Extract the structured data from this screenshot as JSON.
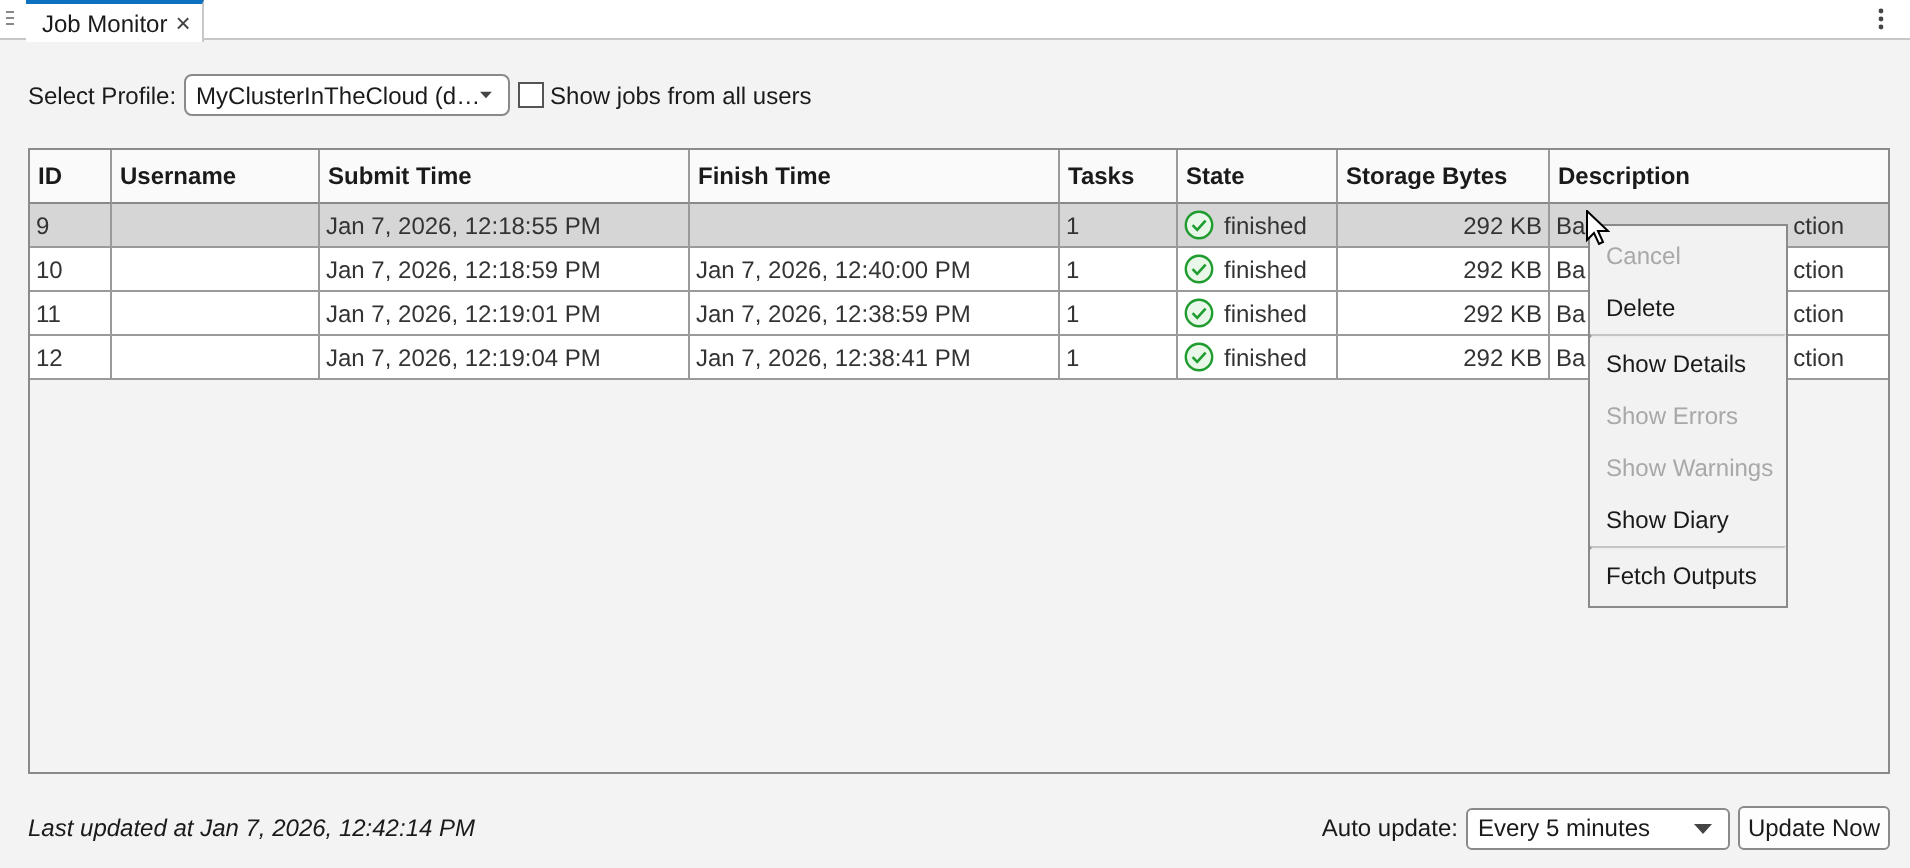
{
  "tab": {
    "title": "Job Monitor",
    "close": "×"
  },
  "profile": {
    "label": "Select Profile:",
    "value": "MyClusterInTheCloud (d…"
  },
  "show_all_users": {
    "label": "Show jobs from all users",
    "checked": false
  },
  "table": {
    "columns": [
      "ID",
      "Username",
      "Submit Time",
      "Finish Time",
      "Tasks",
      "State",
      "Storage Bytes",
      "Description"
    ],
    "rows": [
      {
        "id": "9",
        "username": "",
        "submit_time": "Jan 7, 2026, 12:18:55 PM",
        "finish_time": "",
        "tasks": "1",
        "state": "finished",
        "storage": "292 KB",
        "description_start": "Ba",
        "description_end": "ction",
        "selected": true
      },
      {
        "id": "10",
        "username": "",
        "submit_time": "Jan 7, 2026, 12:18:59 PM",
        "finish_time": "Jan 7, 2026, 12:40:00 PM",
        "tasks": "1",
        "state": "finished",
        "storage": "292 KB",
        "description_start": "Ba",
        "description_end": "ction",
        "selected": false
      },
      {
        "id": "11",
        "username": "",
        "submit_time": "Jan 7, 2026, 12:19:01 PM",
        "finish_time": "Jan 7, 2026, 12:38:59 PM",
        "tasks": "1",
        "state": "finished",
        "storage": "292 KB",
        "description_start": "Ba",
        "description_end": "ction",
        "selected": false
      },
      {
        "id": "12",
        "username": "",
        "submit_time": "Jan 7, 2026, 12:19:04 PM",
        "finish_time": "Jan 7, 2026, 12:38:41 PM",
        "tasks": "1",
        "state": "finished",
        "storage": "292 KB",
        "description_start": "Ba",
        "description_end": "ction",
        "selected": false
      }
    ]
  },
  "context_menu": [
    {
      "label": "Cancel",
      "disabled": true,
      "separator_before": false
    },
    {
      "label": "Delete",
      "disabled": false,
      "separator_before": false
    },
    {
      "label": "Show Details",
      "disabled": false,
      "separator_before": true
    },
    {
      "label": "Show Errors",
      "disabled": true,
      "separator_before": false
    },
    {
      "label": "Show Warnings",
      "disabled": true,
      "separator_before": false
    },
    {
      "label": "Show Diary",
      "disabled": false,
      "separator_before": false
    },
    {
      "label": "Fetch Outputs",
      "disabled": false,
      "separator_before": true
    }
  ],
  "status": "Last updated at Jan 7, 2026, 12:42:14 PM",
  "auto_update": {
    "label": "Auto update:",
    "value": "Every 5 minutes"
  },
  "update_button": "Update Now"
}
